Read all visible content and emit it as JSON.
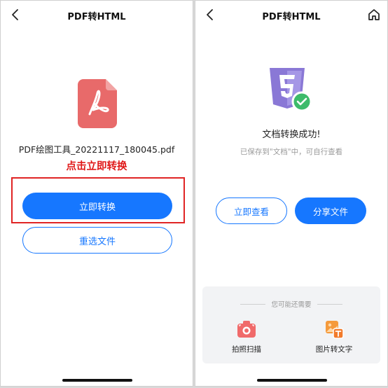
{
  "left": {
    "header_title": "PDF转HTML",
    "file_name": "PDF绘图工具_20221117_180045.pdf",
    "hint": "点击立即转换",
    "convert_label": "立即转换",
    "reselect_label": "重选文件"
  },
  "right": {
    "header_title": "PDF转HTML",
    "success_title": "文档转换成功!",
    "saved_note": "已保存到\"文档\"中，可自行查看",
    "view_label": "立即查看",
    "share_label": "分享文件",
    "suggest_title": "您可能还需要",
    "tools": [
      {
        "label": "拍照扫描",
        "icon": "camera-scan-icon"
      },
      {
        "label": "图片转文字",
        "icon": "image-to-text-icon"
      }
    ]
  },
  "colors": {
    "primary": "#1677ff",
    "hint_red": "#e01818",
    "pdf_red": "#e86a6a",
    "html5_purple": "#8a78d6",
    "success_green": "#3dbb6b"
  }
}
